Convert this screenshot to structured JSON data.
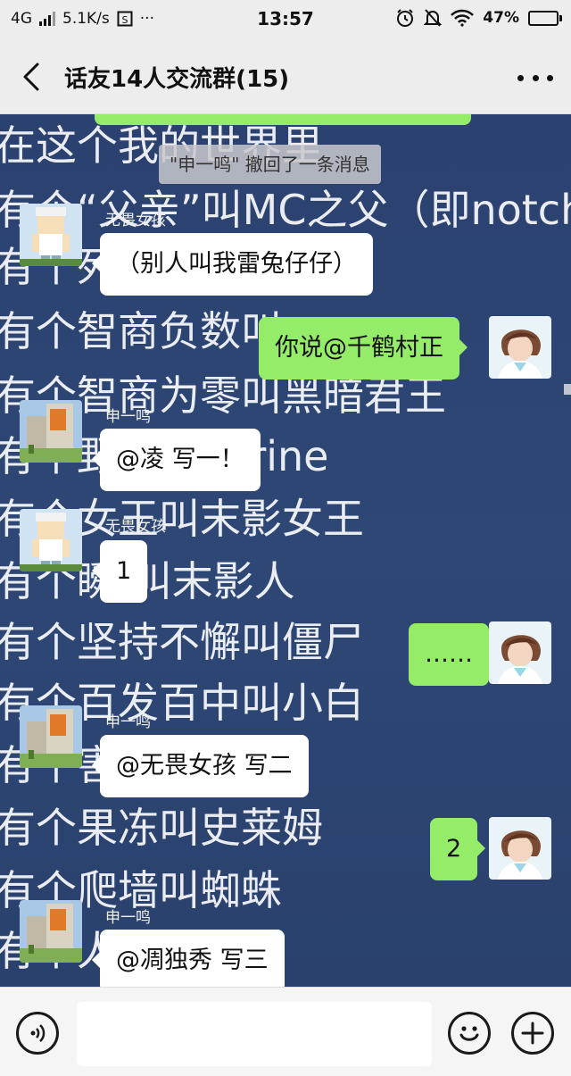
{
  "status_bar": {
    "network": "4G",
    "speed": "5.1K/s",
    "time": "13:57",
    "battery": "47%",
    "battery_level": 0.47
  },
  "header": {
    "title": "话友14人交流群(15)"
  },
  "background_lines": [
    "在这个我的世界里",
    "有个“父亲”叫MC之父（即notch",
    "有个死              （即白衣死",
    "有个智商负数叫",
    "有个智商为零叫黑暗君王",
    "有个野                  herobrine",
    "有个女王叫末影女王",
    "有个瞬    叫末影人",
    "有个坚持不懈叫僵尸",
    "有个百发百中叫小白",
    "有个害              力怕",
    "有个果冻叫史莱姆",
    "有个爬墙叫蜘蛛",
    "有个人"
  ],
  "recall_notice": "\"申一鸣\" 撤回了一条消息",
  "messages": [
    {
      "sender": "无畏女孩",
      "text": "（别人叫我雷兔仔仔）"
    },
    {
      "text": "你说@千鹤村正"
    },
    {
      "sender": "申一鸣",
      "text": "@凌  写一！"
    },
    {
      "sender": "无畏女孩",
      "text": "1"
    },
    {
      "text": "……"
    },
    {
      "sender": "申一鸣",
      "text": "@无畏女孩  写二"
    },
    {
      "text": "2"
    },
    {
      "sender": "申一鸣",
      "text": "@凋独秀  写三"
    }
  ],
  "colors": {
    "chat_bg": "#2c4470",
    "my_bubble": "#95ec69",
    "their_bubble": "#ffffff",
    "bar_bg": "#ededed"
  }
}
